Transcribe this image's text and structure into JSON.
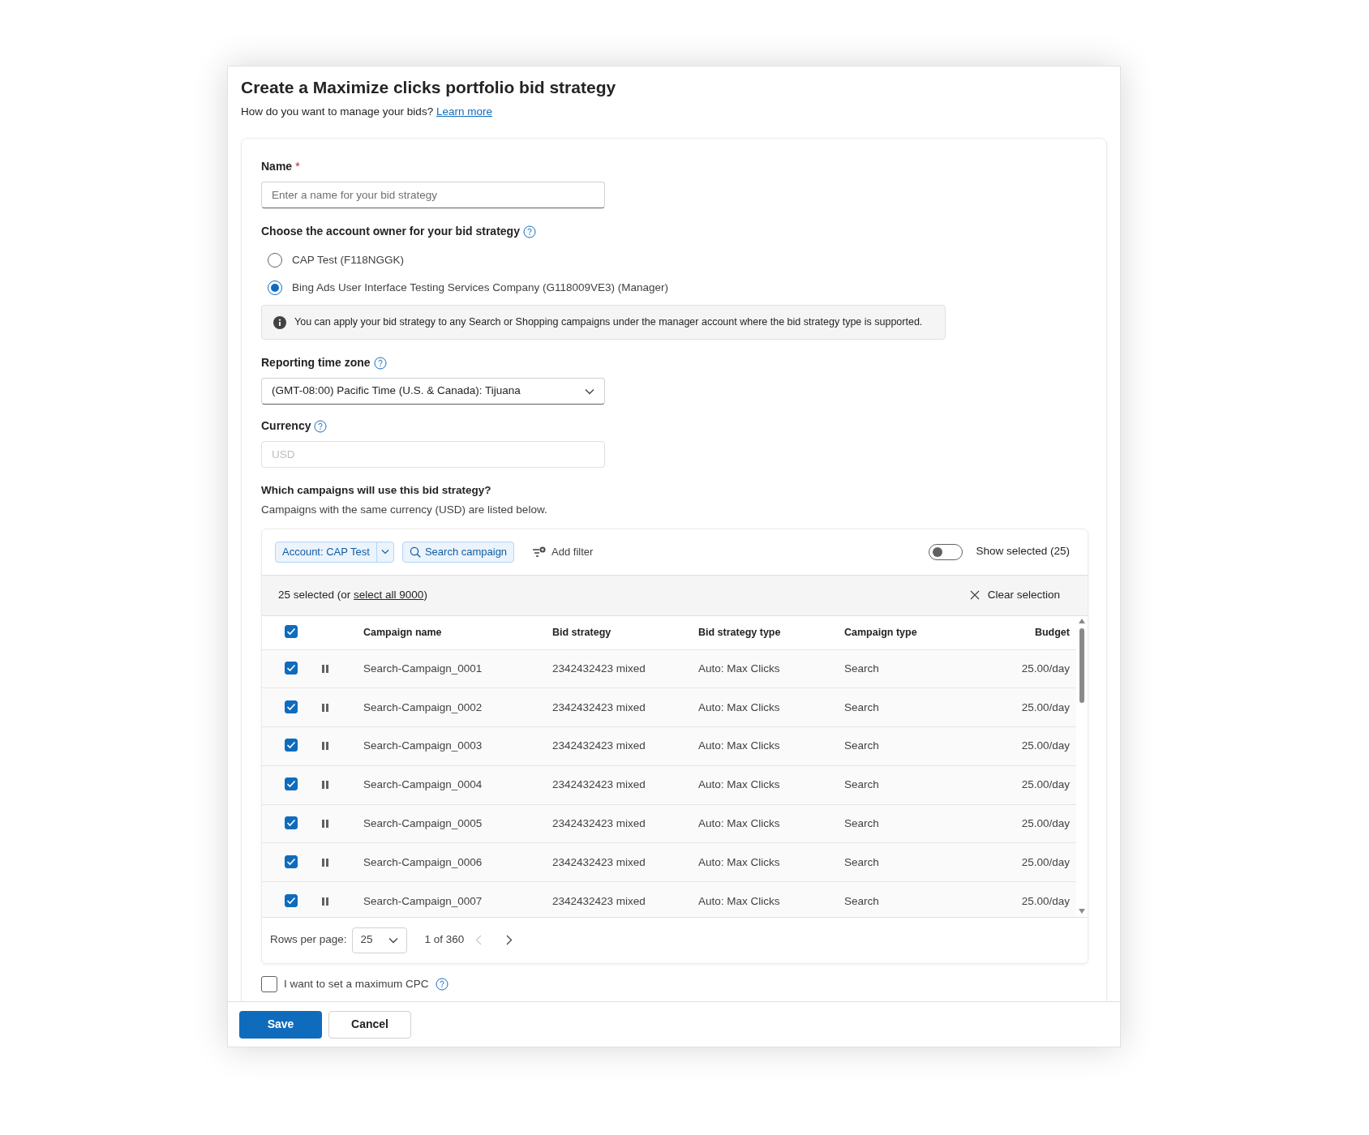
{
  "dialog": {
    "title": "Create a Maximize clicks portfolio bid strategy",
    "subtitle": "How do you want to manage your bids?",
    "learn_more": "Learn more"
  },
  "form": {
    "name": {
      "label": "Name",
      "required_mark": "*",
      "placeholder": "Enter a name for your bid strategy"
    },
    "owner": {
      "label": "Choose the account owner for your bid strategy",
      "options": [
        {
          "label": "CAP Test (F118NGGK)",
          "selected": false
        },
        {
          "label": "Bing Ads User Interface Testing Services Company (G118009VE3) (Manager)",
          "selected": true
        }
      ],
      "info": "You can apply your bid strategy to any Search or Shopping campaigns under the manager account where the bid strategy type is supported."
    },
    "time_zone": {
      "label": "Reporting time zone",
      "value": "(GMT-08:00) Pacific Time (U.S. & Canada): Tijuana"
    },
    "currency": {
      "label": "Currency",
      "value": "USD",
      "disabled": true
    },
    "campaigns": {
      "title": "Which campaigns will use this bid strategy?",
      "subtitle": "Campaigns with the same currency (USD) are listed below.",
      "account_filter": "Account: CAP Test",
      "search": "Search campaign",
      "add_filter": "Add filter",
      "show_selected": {
        "label": "Show selected (25)",
        "on": false
      },
      "selection_prefix": "25 selected (or ",
      "select_all": "select all 9000",
      "selection_suffix": ")",
      "clear_selection": "Clear selection",
      "table": {
        "all_checked": true,
        "columns": [
          "Campaign name",
          "Bid strategy",
          "Bid strategy type",
          "Campaign type",
          "Budget"
        ],
        "rows": [
          {
            "checked": true,
            "paused": true,
            "cells": [
              "Search-Campaign_0001",
              "2342432423 mixed",
              "Auto: Max Clicks",
              "Search",
              "25.00/day"
            ]
          },
          {
            "checked": true,
            "paused": true,
            "cells": [
              "Search-Campaign_0002",
              "2342432423 mixed",
              "Auto: Max Clicks",
              "Search",
              "25.00/day"
            ]
          },
          {
            "checked": true,
            "paused": true,
            "cells": [
              "Search-Campaign_0003",
              "2342432423 mixed",
              "Auto: Max Clicks",
              "Search",
              "25.00/day"
            ]
          },
          {
            "checked": true,
            "paused": true,
            "cells": [
              "Search-Campaign_0004",
              "2342432423 mixed",
              "Auto: Max Clicks",
              "Search",
              "25.00/day"
            ]
          },
          {
            "checked": true,
            "paused": true,
            "cells": [
              "Search-Campaign_0005",
              "2342432423 mixed",
              "Auto: Max Clicks",
              "Search",
              "25.00/day"
            ]
          },
          {
            "checked": true,
            "paused": true,
            "cells": [
              "Search-Campaign_0006",
              "2342432423 mixed",
              "Auto: Max Clicks",
              "Search",
              "25.00/day"
            ]
          },
          {
            "checked": true,
            "paused": true,
            "cells": [
              "Search-Campaign_0007",
              "2342432423 mixed",
              "Auto: Max Clicks",
              "Search",
              "25.00/day"
            ]
          }
        ]
      },
      "pagination": {
        "rows_label": "Rows per page:",
        "rows_value": "25",
        "page": "1 of 360",
        "prev_disabled": true
      }
    },
    "max_cpc": {
      "label": "I want to set a maximum CPC",
      "checked": false
    }
  },
  "buttons": [
    {
      "label": "Save",
      "kind": "primary"
    },
    {
      "label": "Cancel",
      "kind": "secondary"
    }
  ]
}
